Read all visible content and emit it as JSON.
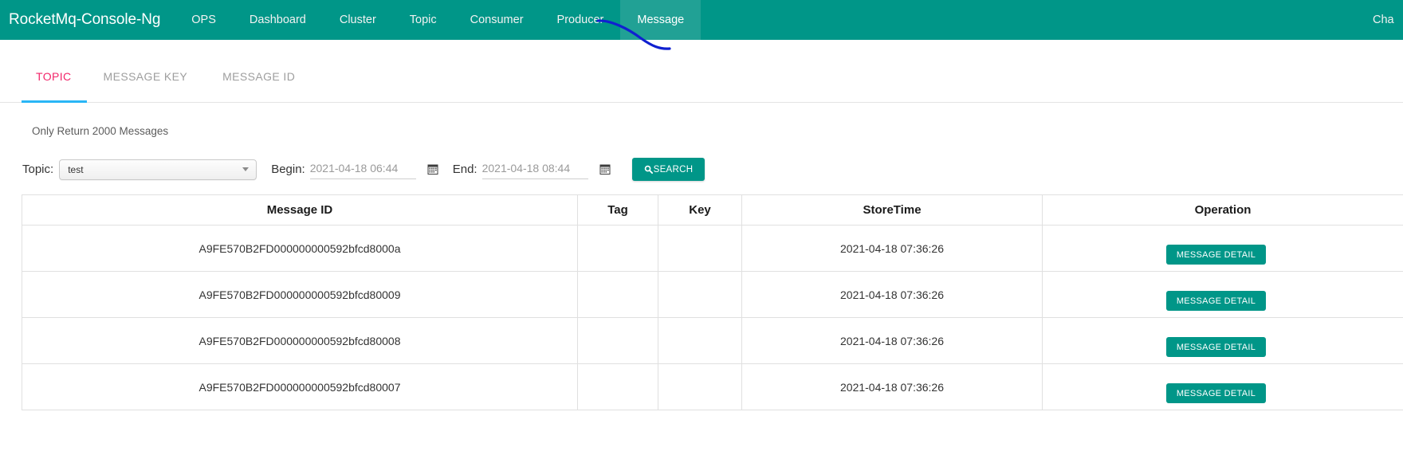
{
  "navbar": {
    "brand": "RocketMq-Console-Ng",
    "items": [
      {
        "label": "OPS",
        "active": false
      },
      {
        "label": "Dashboard",
        "active": false
      },
      {
        "label": "Cluster",
        "active": false
      },
      {
        "label": "Topic",
        "active": false
      },
      {
        "label": "Consumer",
        "active": false
      },
      {
        "label": "Producer",
        "active": false
      },
      {
        "label": "Message",
        "active": true
      }
    ],
    "right_label": "Cha",
    "bg_color": "#009688",
    "active_bg_color": "#21a195",
    "annotation_color": "#1020d0"
  },
  "tabs": {
    "items": [
      {
        "label": "TOPIC",
        "active": true
      },
      {
        "label": "MESSAGE KEY",
        "active": false
      },
      {
        "label": "MESSAGE ID",
        "active": false
      }
    ],
    "active_color": "#f2266a",
    "underline_color": "#29b6f6"
  },
  "note": "Only Return 2000 Messages",
  "form": {
    "topic_label": "Topic:",
    "topic_value": "test",
    "begin_label": "Begin:",
    "begin_value": "2021-04-18 06:44",
    "end_label": "End:",
    "end_value": "2021-04-18 08:44",
    "search_label": "SEARCH",
    "search_icon": "search-icon",
    "calendar_icon": "calendar-icon",
    "button_color": "#009688"
  },
  "table": {
    "headers": [
      "Message ID",
      "Tag",
      "Key",
      "StoreTime",
      "Operation"
    ],
    "action_label": "MESSAGE DETAIL",
    "rows": [
      {
        "message_id": "A9FE570B2FD000000000592bfcd8000a",
        "tag": "",
        "key": "",
        "store_time": "2021-04-18 07:36:26",
        "action": "MESSAGE DETAIL"
      },
      {
        "message_id": "A9FE570B2FD000000000592bfcd80009",
        "tag": "",
        "key": "",
        "store_time": "2021-04-18 07:36:26",
        "action": "MESSAGE DETAIL"
      },
      {
        "message_id": "A9FE570B2FD000000000592bfcd80008",
        "tag": "",
        "key": "",
        "store_time": "2021-04-18 07:36:26",
        "action": "MESSAGE DETAIL"
      },
      {
        "message_id": "A9FE570B2FD000000000592bfcd80007",
        "tag": "",
        "key": "",
        "store_time": "2021-04-18 07:36:26",
        "action": "MESSAGE DETAIL"
      }
    ]
  }
}
